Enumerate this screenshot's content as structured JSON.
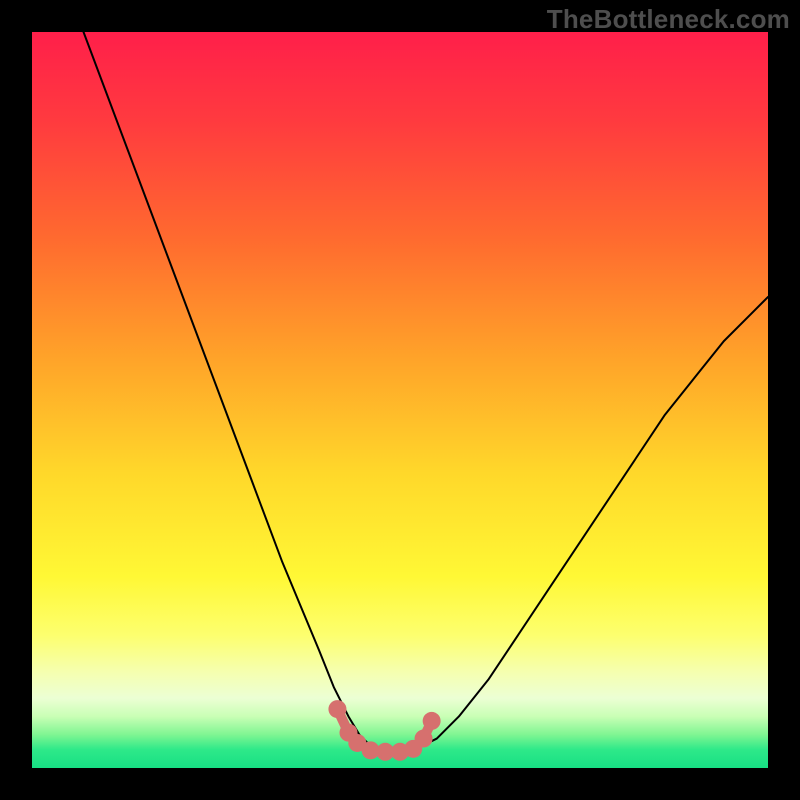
{
  "watermark": {
    "text": "TheBottleneck.com"
  },
  "gradient_stops": [
    {
      "offset": 0.0,
      "color": "#ff1f4a"
    },
    {
      "offset": 0.12,
      "color": "#ff3a3f"
    },
    {
      "offset": 0.28,
      "color": "#ff6a2f"
    },
    {
      "offset": 0.44,
      "color": "#ffa229"
    },
    {
      "offset": 0.6,
      "color": "#ffd82a"
    },
    {
      "offset": 0.74,
      "color": "#fff835"
    },
    {
      "offset": 0.82,
      "color": "#fdff6f"
    },
    {
      "offset": 0.87,
      "color": "#f5ffb0"
    },
    {
      "offset": 0.905,
      "color": "#ecffd4"
    },
    {
      "offset": 0.93,
      "color": "#c9ffb5"
    },
    {
      "offset": 0.955,
      "color": "#7ef592"
    },
    {
      "offset": 0.975,
      "color": "#2ee989"
    },
    {
      "offset": 1.0,
      "color": "#17df84"
    }
  ],
  "chart_data": {
    "type": "line",
    "title": "",
    "xlabel": "",
    "ylabel": "",
    "xlim": [
      0,
      100
    ],
    "ylim": [
      0,
      100
    ],
    "legend": false,
    "grid": false,
    "series": [
      {
        "name": "bottleneck-curve",
        "color": "#000000",
        "stroke_width": 2.0,
        "x": [
          7,
          10,
          13,
          16,
          19,
          22,
          25,
          28,
          31,
          34,
          36.5,
          39,
          41,
          43,
          44.5,
          46,
          48,
          50,
          52,
          55,
          58,
          62,
          66,
          70,
          74,
          78,
          82,
          86,
          90,
          94,
          98,
          100
        ],
        "y": [
          100,
          92,
          84,
          76,
          68,
          60,
          52,
          44,
          36,
          28,
          22,
          16,
          11,
          7,
          4.5,
          3,
          2,
          2,
          2.5,
          4,
          7,
          12,
          18,
          24,
          30,
          36,
          42,
          48,
          53,
          58,
          62,
          64
        ]
      },
      {
        "name": "valley-highlight",
        "color": "#d6706e",
        "stroke_width": 10,
        "dots": true,
        "dot_radius": 9,
        "x": [
          41.5,
          43.0,
          44.2,
          46.0,
          48.0,
          50.0,
          51.8,
          53.2,
          54.3
        ],
        "y": [
          8.0,
          4.8,
          3.4,
          2.4,
          2.2,
          2.2,
          2.6,
          4.0,
          6.4
        ]
      }
    ]
  }
}
